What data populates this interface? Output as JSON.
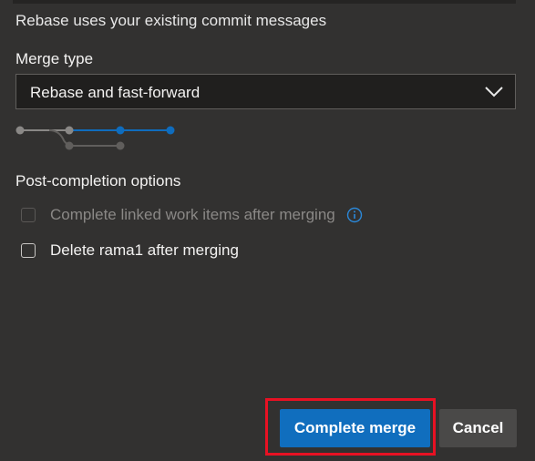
{
  "rebase_note": "Rebase uses your existing commit messages",
  "merge_type": {
    "label": "Merge type",
    "selected": "Rebase and fast-forward",
    "chevron_icon": "chevron-down-icon"
  },
  "diagram": {
    "icon": "rebase-fast-forward-diagram-icon",
    "accent_color": "#0f6cbd",
    "muted_color": "#8a8886"
  },
  "post_completion": {
    "label": "Post-completion options",
    "options": [
      {
        "label": "Complete linked work items after merging",
        "checked": false,
        "disabled": true,
        "info_icon": "info-icon"
      },
      {
        "label": "Delete rama1 after merging",
        "checked": false,
        "disabled": false
      }
    ]
  },
  "actions": {
    "complete_label": "Complete merge",
    "cancel_label": "Cancel",
    "highlight_color": "#e81123"
  }
}
